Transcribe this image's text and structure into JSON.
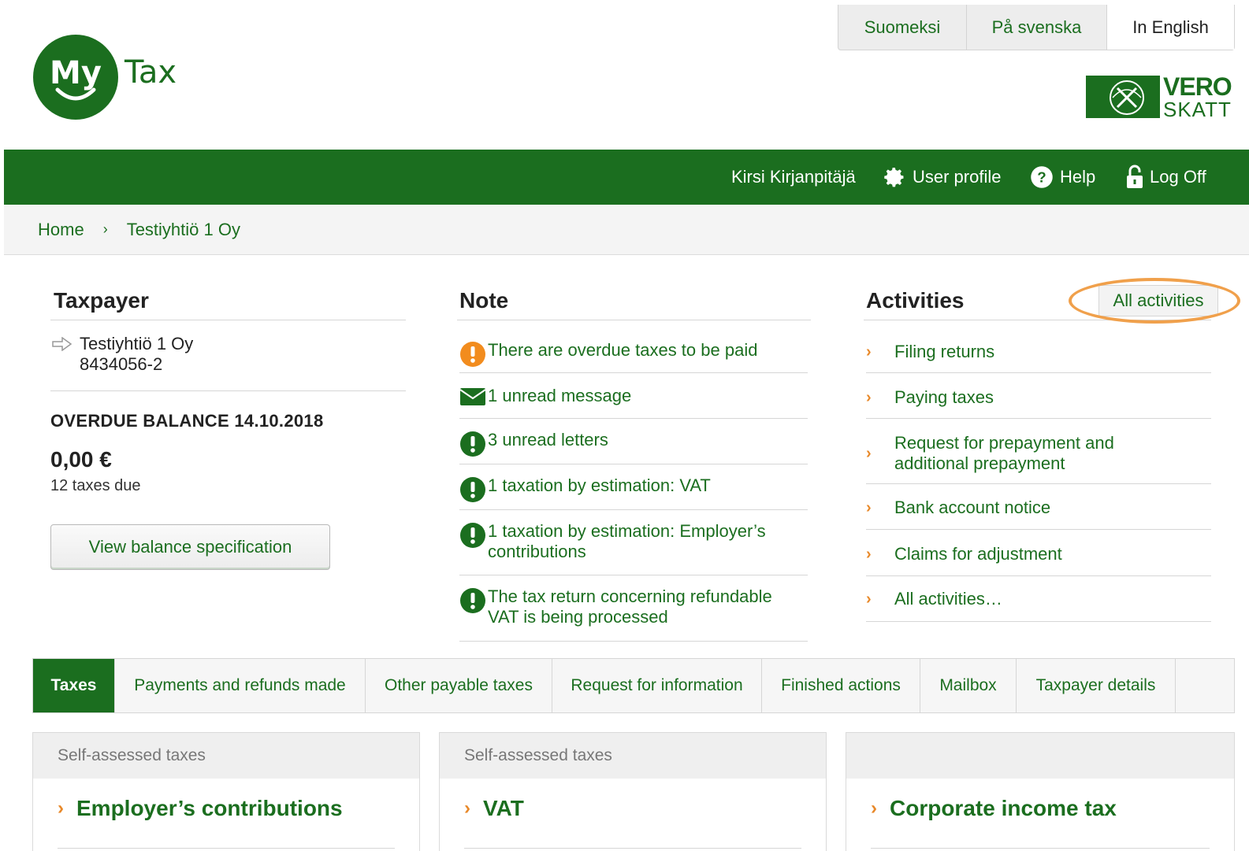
{
  "logo": {
    "my": "My",
    "tax": "Tax"
  },
  "languages": [
    {
      "label": "Suomeksi"
    },
    {
      "label": "På svenska"
    },
    {
      "label": "In English"
    }
  ],
  "vero": {
    "line1": "VERO",
    "line2": "SKATT"
  },
  "topnav": {
    "user": "Kirsi Kirjanpitäjä",
    "profile": "User profile",
    "help": "Help",
    "logoff": "Log Off"
  },
  "breadcrumb": {
    "home": "Home",
    "current": "Testiyhtiö 1 Oy"
  },
  "taxpayer": {
    "title": "Taxpayer",
    "name": "Testiyhtiö 1 Oy",
    "id": "8434056-2",
    "overdue_title": "OVERDUE BALANCE 14.10.2018",
    "amount": "0,00 €",
    "taxes_due": "12 taxes due",
    "button": "View balance specification"
  },
  "note": {
    "title": "Note",
    "items": [
      {
        "icon": "warning-orange-icon",
        "text": "There are overdue taxes to be paid"
      },
      {
        "icon": "envelope-icon",
        "text": "1 unread message"
      },
      {
        "icon": "exclamation-green-icon",
        "text": "3 unread letters"
      },
      {
        "icon": "exclamation-green-icon",
        "text": "1 taxation by estimation: VAT"
      },
      {
        "icon": "exclamation-green-icon",
        "text": "1 taxation by estimation: Employer’s contributions"
      },
      {
        "icon": "exclamation-green-icon",
        "text": "The tax return concerning refundable VAT is being processed"
      }
    ]
  },
  "activities": {
    "title": "Activities",
    "all_button": "All activities",
    "items": [
      {
        "text": "Filing returns"
      },
      {
        "text": "Paying taxes"
      },
      {
        "text": "Request for prepayment and additional prepayment"
      },
      {
        "text": "Bank account notice"
      },
      {
        "text": "Claims for adjustment"
      },
      {
        "text": "All activities…"
      }
    ]
  },
  "tabs": [
    {
      "label": "Taxes"
    },
    {
      "label": "Payments and refunds made"
    },
    {
      "label": "Other payable taxes"
    },
    {
      "label": "Request for information"
    },
    {
      "label": "Finished actions"
    },
    {
      "label": "Mailbox"
    },
    {
      "label": "Taxpayer details"
    }
  ],
  "cards": [
    {
      "head": "Self-assessed taxes",
      "title": "Employer’s contributions"
    },
    {
      "head": "Self-assessed taxes",
      "title": "VAT"
    },
    {
      "head": "",
      "title": "Corporate income tax"
    }
  ],
  "colors": {
    "brand_green": "#1b6e1f",
    "accent_orange": "#e8892a",
    "highlight_ring": "#f0a04b"
  }
}
